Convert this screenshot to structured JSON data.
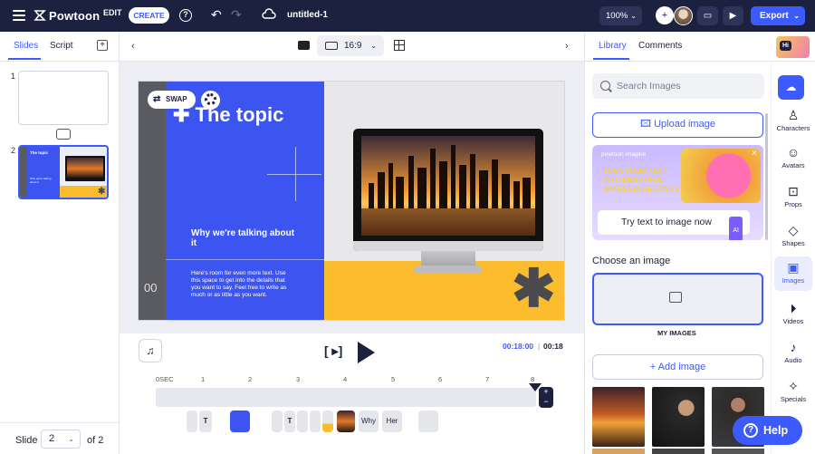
{
  "topbar": {
    "logo": "Powtoon",
    "edit_label": "EDIT",
    "create_label": "CREATE",
    "help_glyph": "?",
    "doc_title": "untitled-1",
    "zoom": "100%",
    "export_label": "Export"
  },
  "left_panel": {
    "tabs": [
      "Slides",
      "Script"
    ],
    "active_tab": "Slides",
    "slides": [
      {
        "number": "1"
      },
      {
        "number": "2",
        "thumb_title": "The topic",
        "thumb_sub": "Why we're talking about it"
      }
    ],
    "footer": {
      "slide_label": "Slide",
      "current": "2",
      "of_label": "of 2"
    }
  },
  "toolbar": {
    "aspect_ratio": "16:9"
  },
  "slide": {
    "swap_label": "SWAP",
    "title": "The topic",
    "subtitle": "Why we're talking about it",
    "body": "Here's room for even more text. Use this space to get into the details that you want to say. Feel free to write as much or as little as you want.",
    "counter": "00",
    "colors": {
      "blue": "#3d55f0",
      "yellow": "#fbbd2e",
      "gray": "#5a5b60"
    }
  },
  "playback": {
    "current_time": "00:18:00",
    "separator": "|",
    "total_time": "00:18",
    "ruler": [
      "0SEC",
      "1",
      "2",
      "3",
      "4",
      "5",
      "6",
      "7",
      "8"
    ]
  },
  "timeline_chips": [
    {
      "text": "T"
    },
    {
      "text": ""
    },
    {
      "text": "T"
    },
    {
      "text": ""
    },
    {
      "text": ""
    },
    {
      "text": "Why"
    },
    {
      "text": "Her"
    },
    {
      "text": ""
    }
  ],
  "right_panel": {
    "tabs": [
      "Library",
      "Comments"
    ],
    "active_tab": "Library",
    "hi_badge": "Hi",
    "search_placeholder": "Search Images",
    "upload_label": "Upload image",
    "promo": {
      "brand": "powtoon imagine",
      "headline": "TURN YOUR TEXT INTO BEAUTIFUL IMAGES IN SECONDS",
      "cta": "Try text to image now",
      "ai_badge": "AI"
    },
    "choose_label": "Choose an image",
    "my_images_label": "MY IMAGES",
    "add_image_label": "+ Add image",
    "rail": [
      {
        "label": "Characters",
        "icon": "character-icon"
      },
      {
        "label": "Avatars",
        "icon": "avatar-icon"
      },
      {
        "label": "Props",
        "icon": "props-icon"
      },
      {
        "label": "Shapes",
        "icon": "shapes-icon"
      },
      {
        "label": "Images",
        "icon": "images-icon"
      },
      {
        "label": "Videos",
        "icon": "videos-icon"
      },
      {
        "label": "Audio",
        "icon": "audio-icon"
      },
      {
        "label": "Specials",
        "icon": "specials-icon"
      }
    ],
    "active_rail": "Images",
    "help_label": "Help"
  }
}
